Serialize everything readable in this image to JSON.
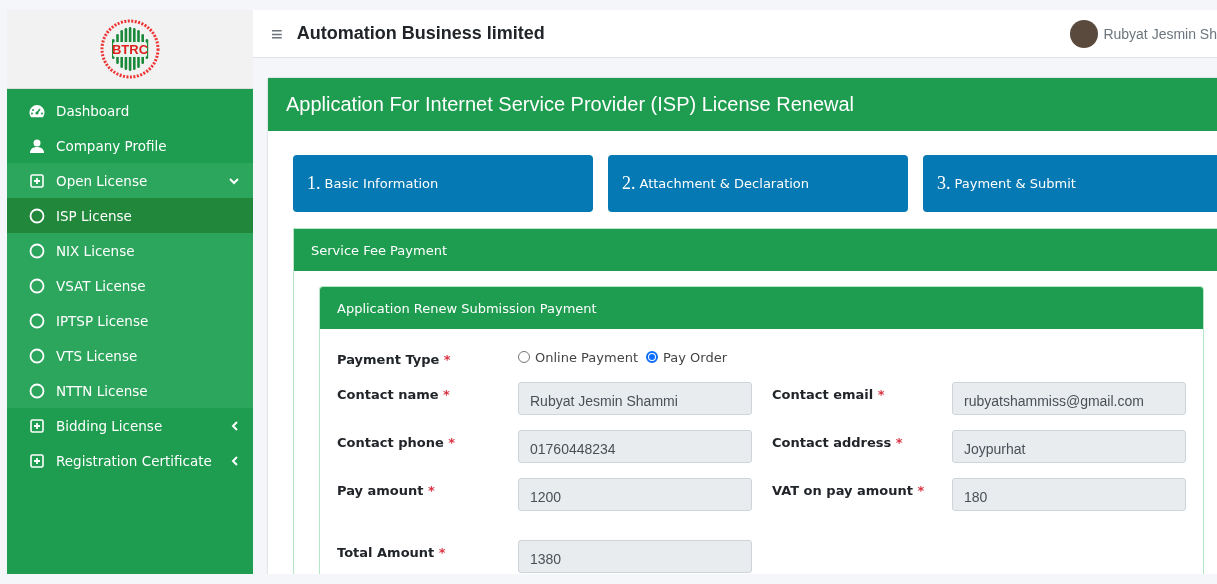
{
  "logo": {
    "text": "BTRC"
  },
  "sidebar": {
    "items": [
      {
        "kind": "link",
        "label": "Dashboard",
        "selected": false
      },
      {
        "kind": "link",
        "label": "Company Profile",
        "selected": false
      },
      {
        "kind": "group",
        "label": "Open License",
        "expanded": true,
        "selected": false,
        "children": [
          {
            "kind": "sub",
            "label": "ISP License",
            "selected": true
          },
          {
            "kind": "sub",
            "label": "NIX License",
            "selected": false
          },
          {
            "kind": "sub",
            "label": "VSAT License",
            "selected": false
          },
          {
            "kind": "sub",
            "label": "IPTSP License",
            "selected": false
          },
          {
            "kind": "sub",
            "label": "VTS License",
            "selected": false
          },
          {
            "kind": "sub",
            "label": "NTTN License",
            "selected": false
          }
        ]
      },
      {
        "kind": "group",
        "label": "Bidding License",
        "expanded": false,
        "selected": false
      },
      {
        "kind": "group",
        "label": "Registration Certificate",
        "expanded": false,
        "selected": false
      }
    ]
  },
  "header": {
    "menu_icon": "≡",
    "company": "Automation Business limited",
    "user_name": "Rubyat Jesmin Sh"
  },
  "page_title": "Application For Internet Service Provider (ISP) License Renewal",
  "steps": [
    {
      "number": "1.",
      "label": "Basic Information"
    },
    {
      "number": "2.",
      "label": "Attachment & Declaration"
    },
    {
      "number": "3.",
      "label": "Payment & Submit"
    }
  ],
  "panel": {
    "title": "Service Fee Payment",
    "inner_title": "Application Renew Submission Payment",
    "payment_type": {
      "label": "Payment Type",
      "required": "*",
      "options": [
        {
          "label": "Online Payment",
          "selected": false
        },
        {
          "label": "Pay Order",
          "selected": true
        }
      ]
    },
    "fields": [
      {
        "label": "Contact name",
        "required": "*",
        "value": "Rubyat Jesmin Shammi"
      },
      {
        "label": "Contact email",
        "required": "*",
        "value": "rubyatshammiss@gmail.com"
      },
      {
        "label": "Contact phone",
        "required": "*",
        "value": "01760448234"
      },
      {
        "label": "Contact address",
        "required": "*",
        "value": "Joypurhat"
      },
      {
        "label": "Pay amount",
        "required": "*",
        "value": "1200"
      },
      {
        "label": "VAT on pay amount",
        "required": "*",
        "value": "180"
      },
      {
        "label": "Total Amount",
        "required": "*",
        "value": "1380"
      }
    ]
  }
}
